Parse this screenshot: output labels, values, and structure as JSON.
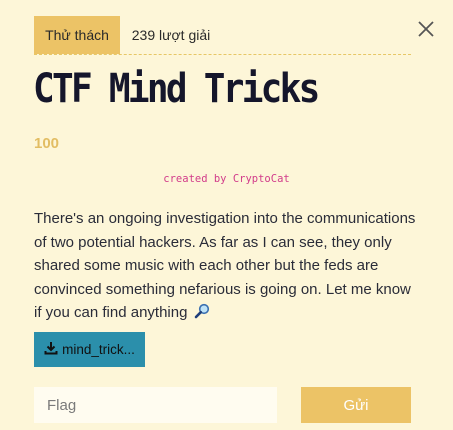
{
  "tabs": {
    "challenge": "Thử thách",
    "solves": "239 lượt giải"
  },
  "challenge": {
    "title": "CTF Mind Tricks",
    "points": "100",
    "author": "created by CryptoCat",
    "description": "There's an ongoing investigation into the communications of two potential hackers. As far as I can see, they only shared some music with each other but the feds are convinced something nefarious is going on. Let me know if you can find anything"
  },
  "file": {
    "label": "mind_trick..."
  },
  "form": {
    "flag_placeholder": "Flag",
    "submit_label": "Gửi"
  },
  "colors": {
    "background": "#fdf6d8",
    "accent": "#ecc366",
    "file_button": "#2b8fab",
    "author": "#d23c8a",
    "points": "#e2bd63"
  },
  "icons": {
    "close": "close-icon",
    "download": "download-icon",
    "emoji": "magnifier-icon"
  }
}
